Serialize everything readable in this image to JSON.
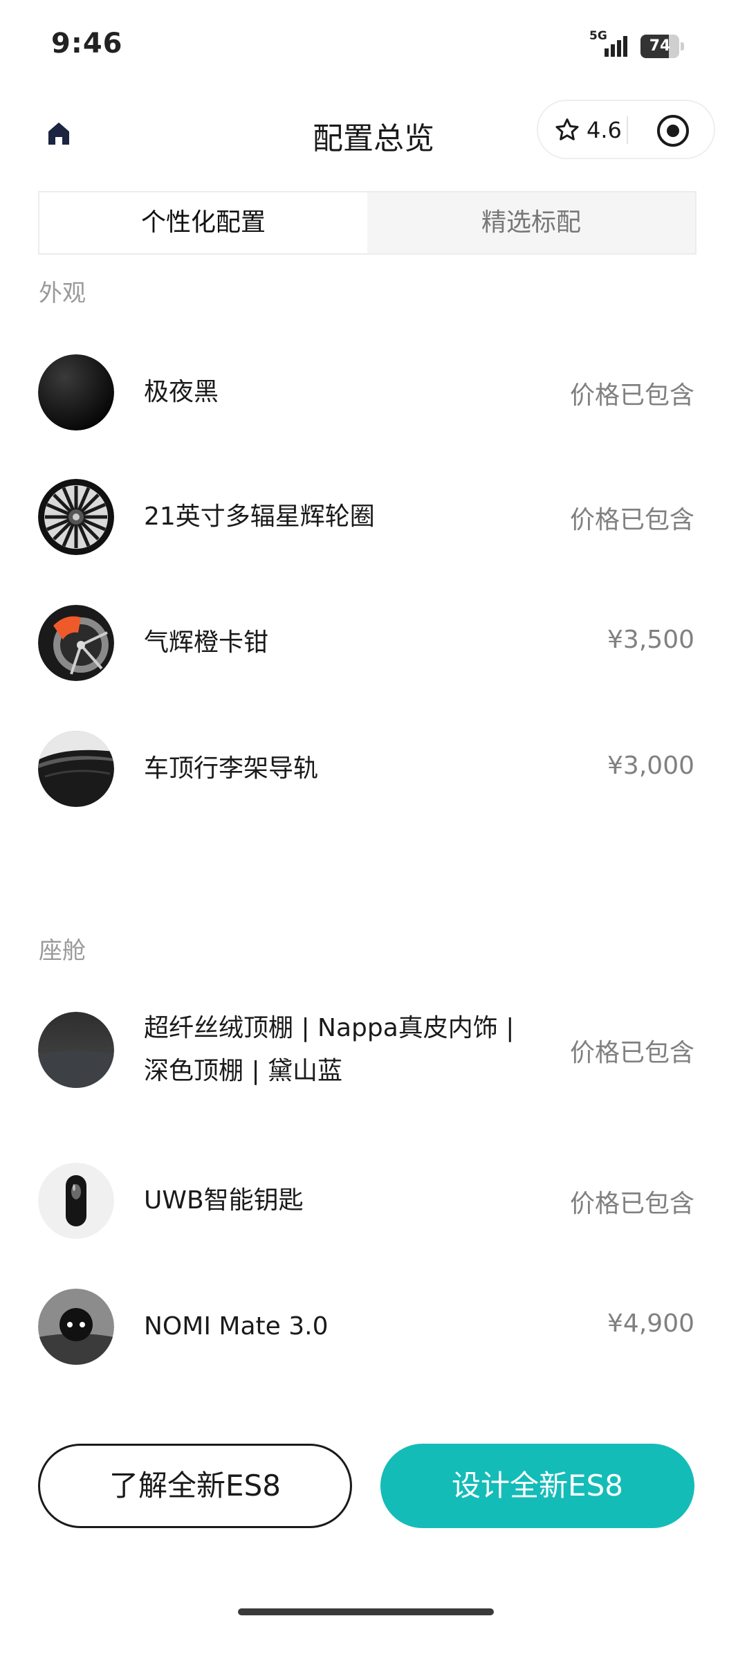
{
  "status_bar": {
    "time": "9:46",
    "network": "5G",
    "battery": "74",
    "battery_level": 0.74
  },
  "header": {
    "title": "配置总览",
    "rating": "4.6"
  },
  "tabs": [
    {
      "label": "个性化配置",
      "active": true
    },
    {
      "label": "精选标配",
      "active": false
    }
  ],
  "sections": {
    "exterior": {
      "label": "外观",
      "items": [
        {
          "name": "极夜黑",
          "price": "价格已包含",
          "icon": "black-paint-swatch"
        },
        {
          "name": "21英寸多辐星辉轮圈",
          "price": "价格已包含",
          "icon": "wheel-rim"
        },
        {
          "name": "气辉橙卡钳",
          "price": "¥3,500",
          "icon": "orange-brake-caliper"
        },
        {
          "name": "车顶行李架导轨",
          "price": "¥3,000",
          "icon": "roof-rail"
        }
      ]
    },
    "cabin": {
      "label": "座舱",
      "items": [
        {
          "name_line1": "超纤丝绒顶棚 | Nappa真皮内饰 |",
          "name_line2": "深色顶棚 | 黛山蓝",
          "price": "价格已包含",
          "icon": "interior-fabric-swatch"
        },
        {
          "name": "UWB智能钥匙",
          "price": "价格已包含",
          "icon": "smart-key"
        },
        {
          "name": "NOMI Mate 3.0",
          "price": "¥4,900",
          "icon": "nomi-mate"
        }
      ]
    }
  },
  "buttons": {
    "learn": "了解全新ES8",
    "design": "设计全新ES8"
  },
  "colors": {
    "accent": "#14bcb8",
    "text": "#1a1a1a",
    "muted": "#808080"
  }
}
